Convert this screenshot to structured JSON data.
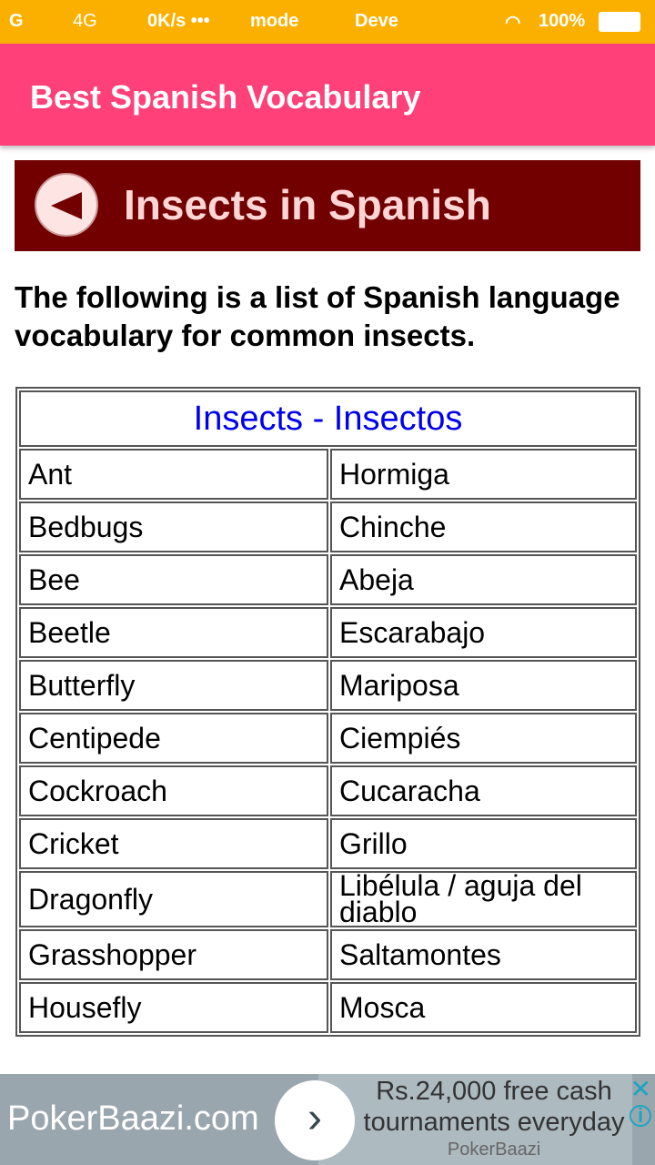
{
  "status_bar": {
    "signal1": "G",
    "signal2": "4G",
    "speed": "0K/s •••",
    "text1": "mode",
    "text2": "Deve",
    "battery": "100%"
  },
  "app": {
    "title": "Best Spanish Vocabulary"
  },
  "banner": {
    "title": "Insects in Spanish"
  },
  "intro": "The following is a list of Spanish language vocabulary for common insects.",
  "table": {
    "header": "Insects - Insectos",
    "rows": [
      [
        "Ant",
        "Hormiga"
      ],
      [
        "Bedbugs",
        "Chinche"
      ],
      [
        "Bee",
        "Abeja"
      ],
      [
        "Beetle",
        "Escarabajo"
      ],
      [
        "Butterfly",
        "Mariposa"
      ],
      [
        "Centipede",
        "Ciempiés"
      ],
      [
        "Cockroach",
        "Cucaracha"
      ],
      [
        "Cricket",
        "Grillo"
      ],
      [
        "Dragonfly",
        "Libélula / aguja del diablo"
      ],
      [
        "Grasshopper",
        "Saltamontes"
      ],
      [
        "Housefly",
        "Mosca"
      ]
    ]
  },
  "ad": {
    "brand": "PokerBaazi.com",
    "headline": "Rs.24,000 free cash tournaments everyday",
    "advertiser": "PokerBaazi",
    "close": "✕",
    "info": "i",
    "go": "›"
  },
  "colors": {
    "status_bar": "#fbb000",
    "app_bar": "#ff4079",
    "banner": "#720000",
    "table_header": "#0000ee"
  }
}
